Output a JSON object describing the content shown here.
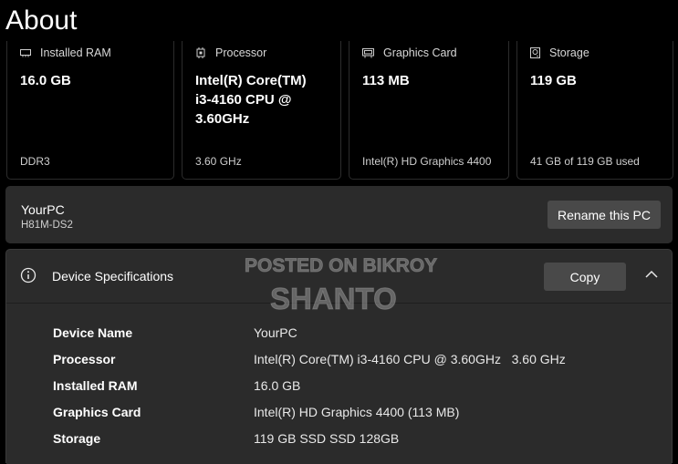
{
  "page_title": "About",
  "cards": [
    {
      "label": "Installed RAM",
      "value": "16.0 GB",
      "sub": "DDR3",
      "icon": "ram-icon"
    },
    {
      "label": "Processor",
      "value_lines": [
        "Intel(R) Core(TM)",
        "i3-4160 CPU @",
        "3.60GHz"
      ],
      "sub": "3.60 GHz",
      "icon": "processor-icon"
    },
    {
      "label": "Graphics Card",
      "value": "113 MB",
      "sub": "Intel(R) HD Graphics 4400",
      "icon": "graphics-card-icon"
    },
    {
      "label": "Storage",
      "value": "119 GB",
      "sub": "41 GB of 119 GB used",
      "icon": "storage-icon"
    }
  ],
  "pc": {
    "name": "YourPC",
    "model": "H81M-DS2",
    "rename_label": "Rename this PC"
  },
  "specs": {
    "title": "Device Specifications",
    "copy_label": "Copy",
    "rows": [
      {
        "key": "Device Name",
        "value": "YourPC"
      },
      {
        "key": "Processor",
        "value": "Intel(R) Core(TM) i3-4160 CPU @ 3.60GHz   3.60 GHz"
      },
      {
        "key": "Installed RAM",
        "value": "16.0 GB"
      },
      {
        "key": "Graphics Card",
        "value": "Intel(R) HD Graphics 4400 (113 MB)"
      },
      {
        "key": "Storage",
        "value": "119 GB SSD SSD 128GB"
      }
    ]
  },
  "watermark": {
    "line1": "POSTED ON BIKROY",
    "line2": "SHANTO"
  }
}
